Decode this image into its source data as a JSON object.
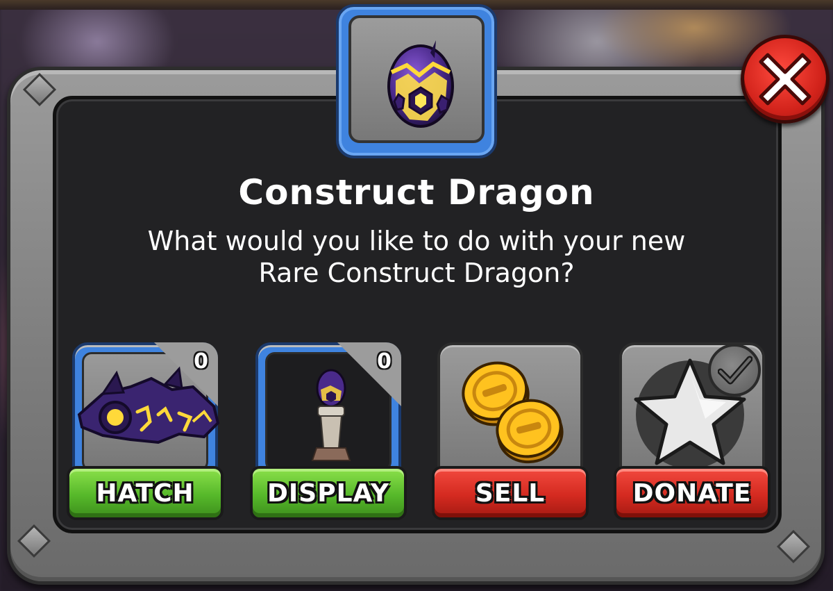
{
  "dialog": {
    "title": "Construct Dragon",
    "question": "What would you like to do with your new\nRare Construct Dragon?"
  },
  "options": [
    {
      "key": "hatch",
      "label": "HATCH",
      "count": "0",
      "color": "green",
      "icon": "dragon-icon",
      "selected": true
    },
    {
      "key": "display",
      "label": "DISPLAY",
      "count": "0",
      "color": "green",
      "icon": "egg-pedestal-icon",
      "selected": true
    },
    {
      "key": "sell",
      "label": "SELL",
      "color": "red",
      "icon": "gold-coins-icon",
      "selected": false
    },
    {
      "key": "donate",
      "label": "DONATE",
      "color": "red",
      "icon": "star-icon",
      "selected": false,
      "badge": "checkmark-icon"
    }
  ],
  "colors": {
    "accent_blue": "#3f83df",
    "button_green": "#56b82a",
    "button_red": "#d42a20",
    "panel_dark": "#222224",
    "panel_frame": "#8a8a8a",
    "egg_purple": "#4a2a8a",
    "egg_glow": "#ffd93a"
  }
}
